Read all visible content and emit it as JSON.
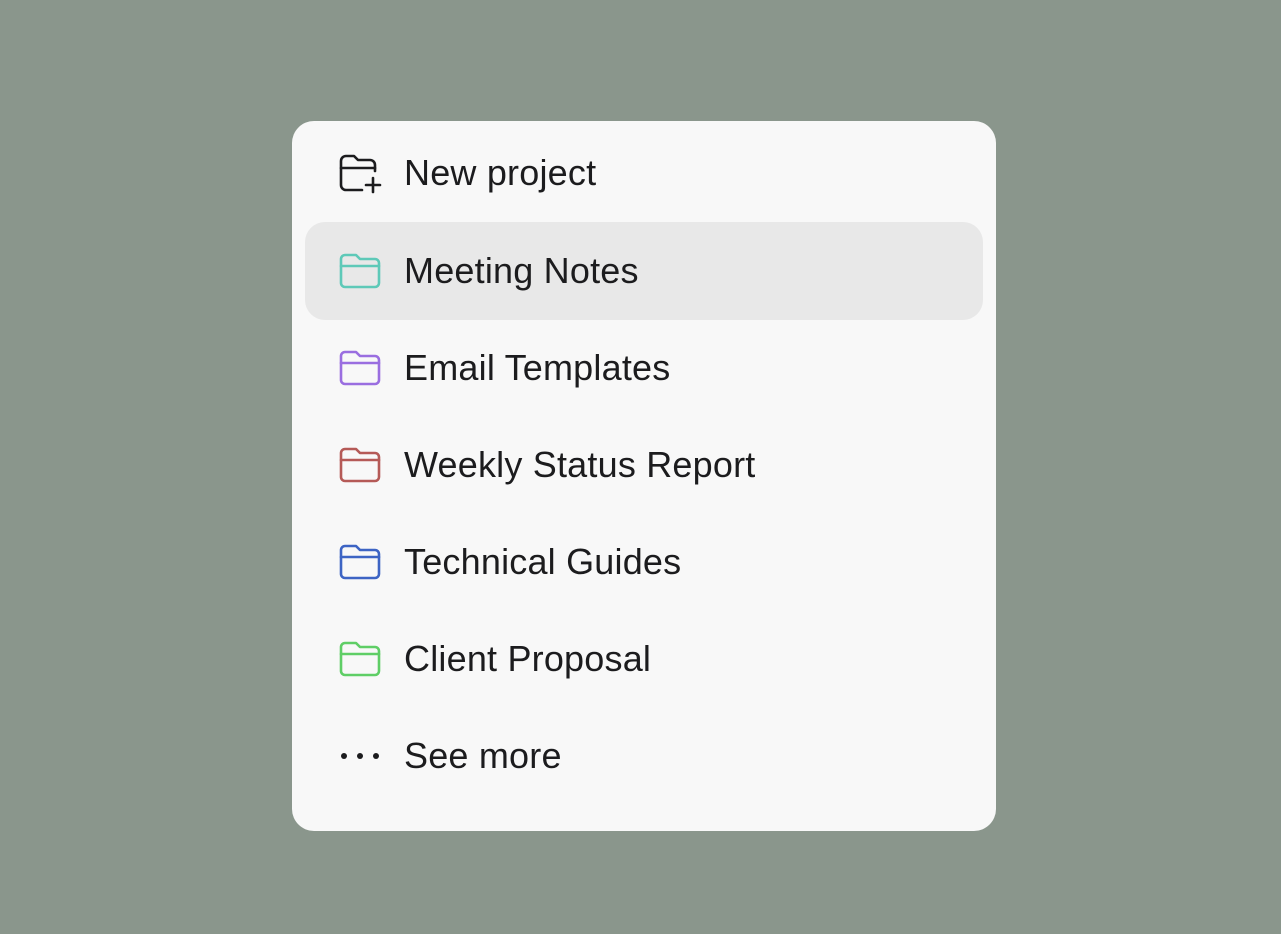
{
  "menu": {
    "items": [
      {
        "id": "new-project",
        "label": "New project",
        "icon": "folder-plus-icon",
        "color": "#1c1c1e",
        "selected": false
      },
      {
        "id": "meeting-notes",
        "label": "Meeting Notes",
        "icon": "folder-icon",
        "color": "#5ec9b8",
        "selected": true
      },
      {
        "id": "email-templates",
        "label": "Email Templates",
        "icon": "folder-icon",
        "color": "#9a6ee0",
        "selected": false
      },
      {
        "id": "weekly-status-report",
        "label": "Weekly Status Report",
        "icon": "folder-icon",
        "color": "#b55a57",
        "selected": false
      },
      {
        "id": "technical-guides",
        "label": "Technical Guides",
        "icon": "folder-icon",
        "color": "#3d64c4",
        "selected": false
      },
      {
        "id": "client-proposal",
        "label": "Client Proposal",
        "icon": "folder-icon",
        "color": "#5fce66",
        "selected": false
      },
      {
        "id": "see-more",
        "label": "See more",
        "icon": "more-dots-icon",
        "color": "#1c1c1e",
        "selected": false
      }
    ]
  },
  "colors": {
    "background": "#8a968c",
    "menu_background": "#f8f8f8",
    "selected_background": "#e8e8e8",
    "text": "#1c1c1e"
  }
}
